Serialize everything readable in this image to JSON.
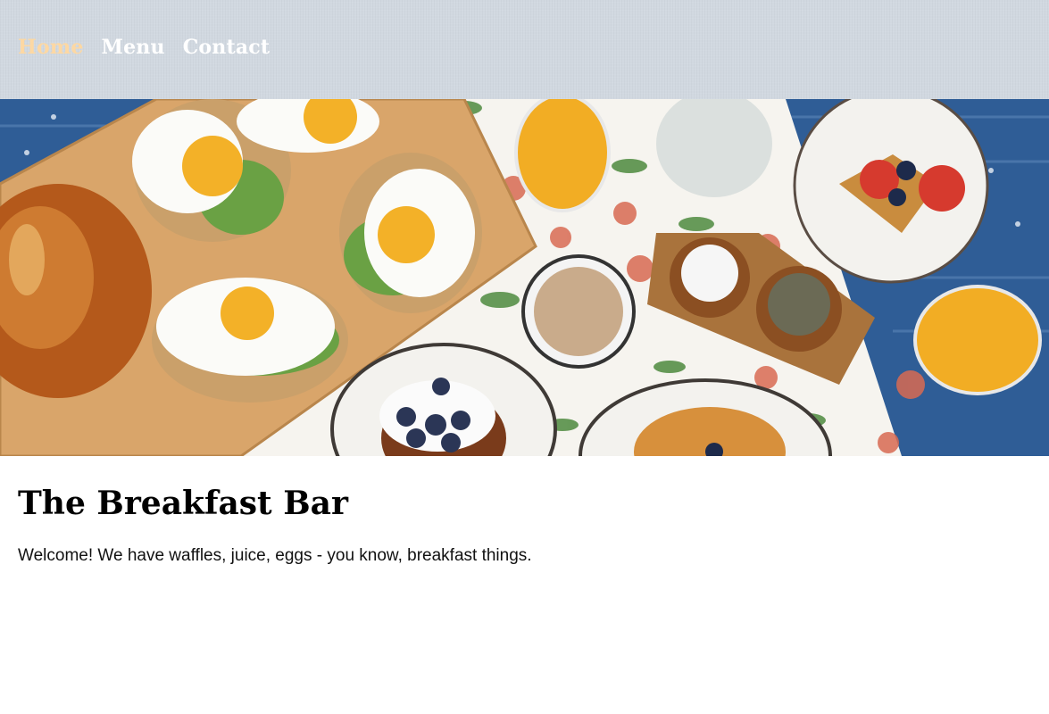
{
  "nav": {
    "items": [
      {
        "label": "Home",
        "active": true
      },
      {
        "label": "Menu",
        "active": false
      },
      {
        "label": "Contact",
        "active": false
      }
    ]
  },
  "hero": {
    "description": "Breakfast spread: fried eggs on avocado toast, orange juice, coffee, waffles with berries"
  },
  "main": {
    "title": "The Breakfast Bar",
    "welcome": "Welcome! We have waffles, juice, eggs - you know, breakfast things."
  },
  "colors": {
    "nav_bg": "#d1d8e0",
    "nav_active": "#fdd8a3",
    "nav_text": "#ffffff",
    "text": "#000000"
  }
}
